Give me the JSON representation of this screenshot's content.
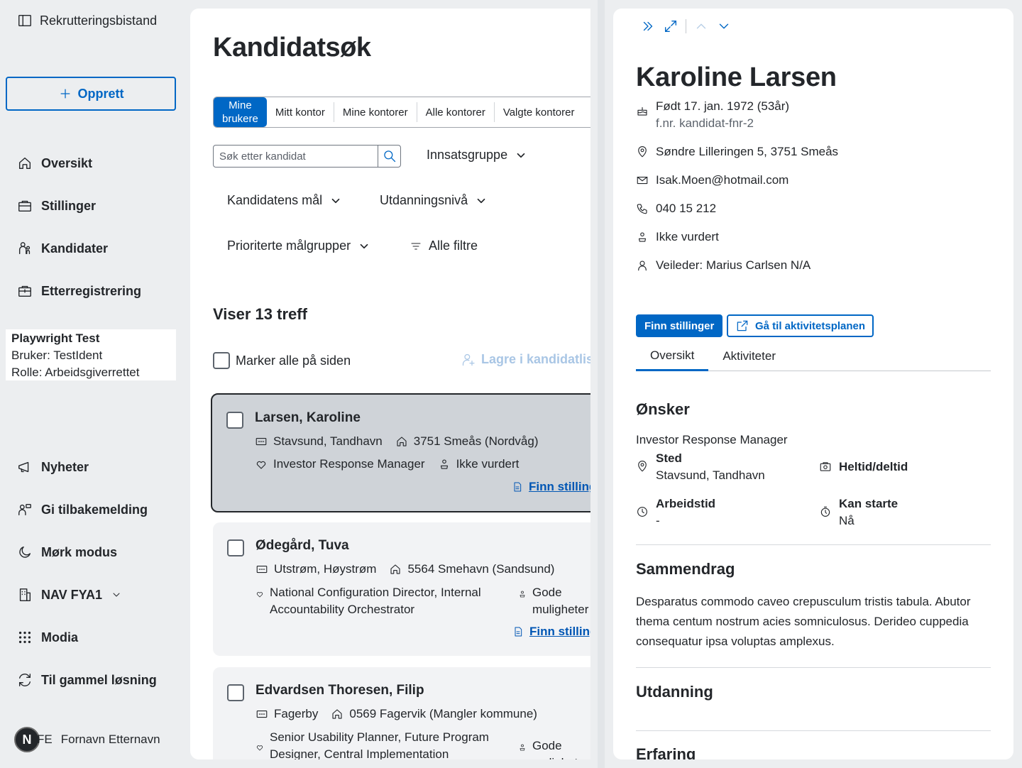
{
  "app": {
    "title": "Rekrutteringsbistand"
  },
  "sidebar": {
    "create_label": "Opprett",
    "nav": [
      {
        "label": "Oversikt",
        "icon": "home-icon"
      },
      {
        "label": "Stillinger",
        "icon": "briefcase-icon"
      },
      {
        "label": "Kandidater",
        "icon": "people-icon"
      },
      {
        "label": "Etterregistrering",
        "icon": "briefcase-plus-icon"
      }
    ],
    "user": {
      "name": "Playwright Test",
      "ident": "Bruker: TestIdent",
      "role": "Rolle: Arbeidsgiverrettet"
    },
    "bottom_nav": [
      {
        "label": "Nyheter",
        "icon": "megaphone-icon"
      },
      {
        "label": "Gi tilbakemelding",
        "icon": "feedback-icon"
      },
      {
        "label": "Mørk modus",
        "icon": "moon-icon"
      },
      {
        "label": "NAV FYA1",
        "icon": "building-icon"
      },
      {
        "label": "Modia",
        "icon": "grid-icon"
      },
      {
        "label": "Til gammel løsning",
        "icon": "swap-icon"
      }
    ],
    "avatar_letter": "N",
    "initials": "FE",
    "user_fullname": "Fornavn Etternavn"
  },
  "search": {
    "title": "Kandidatsøk",
    "toggles": [
      "Mine brukere",
      "Mitt kontor",
      "Mine kontorer",
      "Alle kontorer",
      "Valgte kontorer"
    ],
    "toggle_active_line1": "Mine",
    "toggle_active_line2": "brukere",
    "placeholder": "Søk etter kandidat",
    "filters": {
      "innsatsgruppe": "Innsatsgruppe",
      "maal": "Kandidatens mål",
      "utdanning": "Utdanningsnivå",
      "malgrupper": "Prioriterte målgrupper",
      "alle": "Alle filtre"
    },
    "result_count": "Viser 13 treff",
    "select_all": "Marker alle på siden",
    "save_list": "Lagre i kandidatliste",
    "find_jobs": "Finn stillinger",
    "results": [
      {
        "name": "Larsen, Karoline",
        "place": "Stavsund, Tandhavn",
        "address": "3751 Smeås (Nordvåg)",
        "goal": "Investor Response Manager",
        "status": "Ikke vurdert"
      },
      {
        "name": "Ødegård, Tuva",
        "place": "Utstrøm, Høystrøm",
        "address": "5564 Smehavn (Sandsund)",
        "goal": "National Configuration Director, Internal Accountability Orchestrator",
        "status": "Gode muligheter"
      },
      {
        "name": "Edvardsen Thoresen, Filip",
        "place": "Fagerby",
        "address": "0569 Fagervik (Mangler kommune)",
        "goal": "Senior Usability Planner, Future Program Designer, Central Implementation",
        "status": "Gode muligheter"
      }
    ]
  },
  "detail": {
    "name": "Karoline Larsen",
    "born": "Født 17. jan. 1972 (53år)",
    "fnr": "f.nr. kandidat-fnr-2",
    "address": "Søndre Lilleringen 5, 3751 Smeås",
    "email": "Isak.Moen@hotmail.com",
    "phone": "040 15 212",
    "assessment": "Ikke vurdert",
    "advisor": "Veileder: Marius Carlsen N/A",
    "btn_find": "Finn stillinger",
    "btn_plan": "Gå til aktivitetsplanen",
    "tabs": [
      "Oversikt",
      "Aktiviteter"
    ],
    "wishes": {
      "heading": "Ønsker",
      "job": "Investor Response Manager",
      "place_label": "Sted",
      "place_value": "Stavsund, Tandhavn",
      "extent_label": "Heltid/deltid",
      "hours_label": "Arbeidstid",
      "hours_value": "-",
      "start_label": "Kan starte",
      "start_value": "Nå"
    },
    "summary": {
      "heading": "Sammendrag",
      "text": "Desparatus commodo caveo crepusculum tristis tabula. Abutor thema centum nostrum acies somniculosus. Derideo cuppedia consequatur ipsa voluptas amplexus."
    },
    "education_heading": "Utdanning",
    "experience_heading": "Erfaring"
  },
  "colors": {
    "accent": "#0067c5",
    "background": "#eceef0",
    "selected_card": "#cfd3d8"
  }
}
